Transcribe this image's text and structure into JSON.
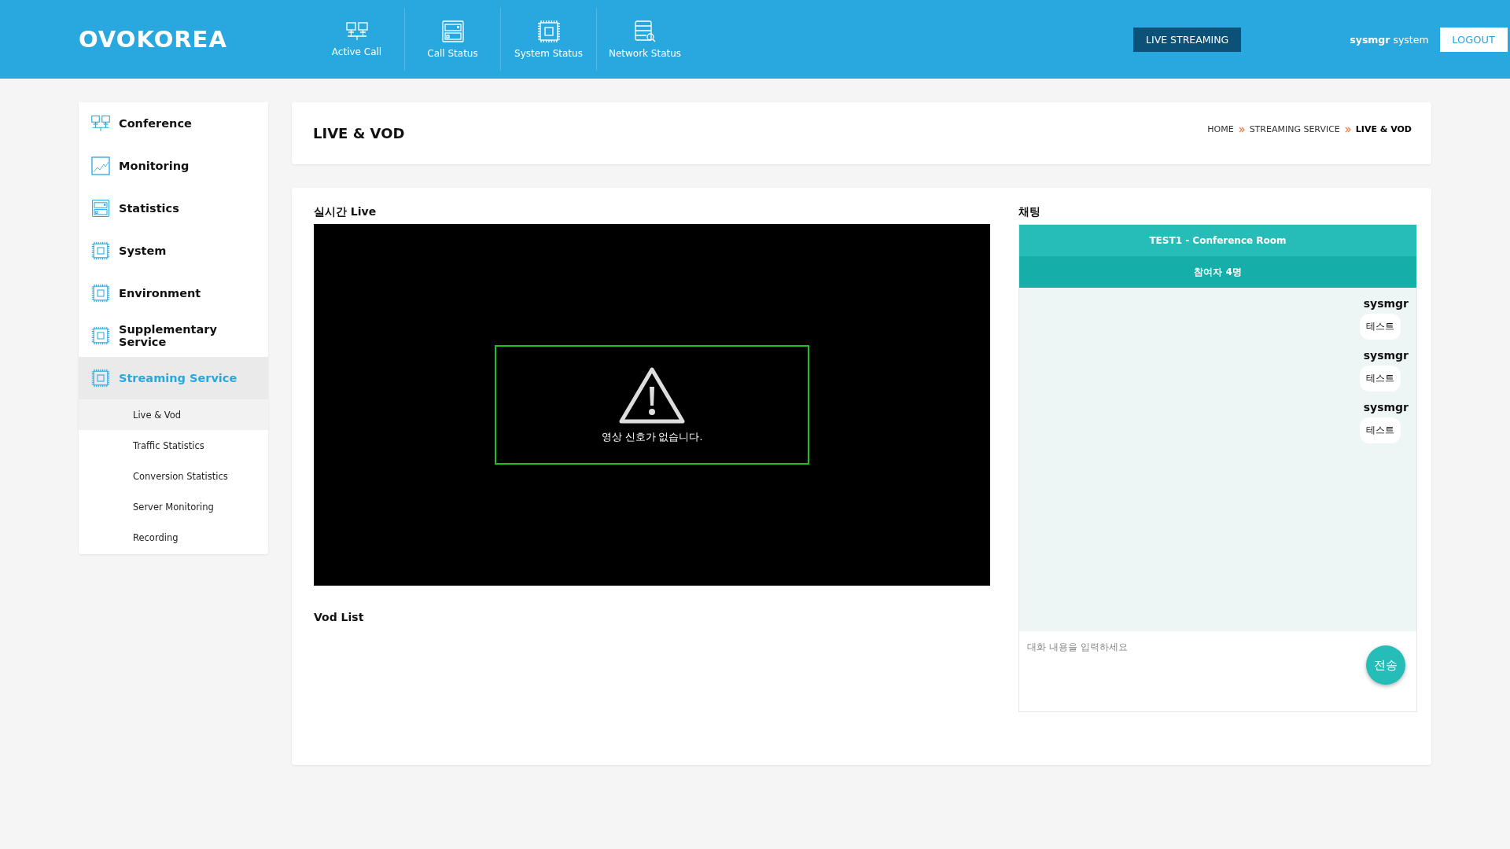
{
  "header": {
    "logo": "OVOKOREA",
    "nav": [
      {
        "label": "Active Call"
      },
      {
        "label": "Call Status"
      },
      {
        "label": "System Status"
      },
      {
        "label": "Network Status"
      }
    ],
    "live_button": "LIVE STREAMING",
    "user": "**sysmgr** system",
    "logout": "LOGOUT"
  },
  "sidebar": {
    "items": [
      {
        "label": "Conference",
        "selected": false
      },
      {
        "label": "Monitoring",
        "selected": false
      },
      {
        "label": "Statistics",
        "selected": false
      },
      {
        "label": "System",
        "selected": false
      },
      {
        "label": "Environment",
        "selected": false
      },
      {
        "label": "Supplementary Service",
        "selected": false
      },
      {
        "label": "Streaming Service",
        "selected": true,
        "expanded": true,
        "children": [
          {
            "label": "Live & Vod",
            "selected": true
          },
          {
            "label": "Traffic Statistics",
            "selected": false
          },
          {
            "label": "Conversion Statistics",
            "selected": false
          },
          {
            "label": "Server Monitoring",
            "selected": false
          },
          {
            "label": "Recording",
            "selected": false
          }
        ]
      }
    ]
  },
  "page": {
    "title": "LIVE & VOD",
    "breadcrumb": [
      "HOME",
      "STREAMING SERVICE",
      "LIVE & VOD"
    ]
  },
  "live": {
    "title": "실시간 Live",
    "message": "영상 신호가 없습니다."
  },
  "vod": {
    "title": "Vod List"
  },
  "chat": {
    "title": "채팅",
    "room": "TEST1 - Conference Room",
    "participants": "참여자 4명",
    "messages": [
      {
        "user": "sysmgr",
        "text": "테스트"
      },
      {
        "user": "sysmgr",
        "text": "테스트"
      },
      {
        "user": "sysmgr",
        "text": "테스트"
      }
    ],
    "input": {
      "placeholder": "대화 내용을 입력하세요"
    },
    "send": "전송"
  }
}
